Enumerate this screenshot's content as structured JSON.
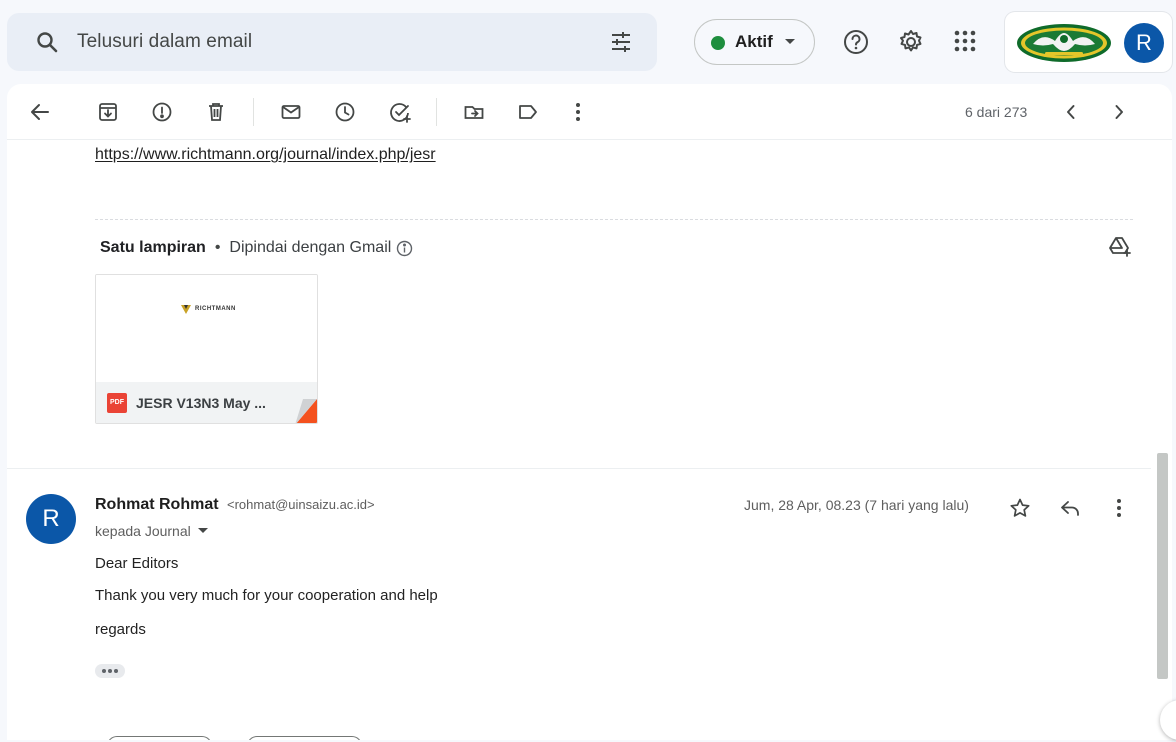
{
  "search": {
    "placeholder": "Telusuri dalam email"
  },
  "status": {
    "label": "Aktif",
    "color": "#1e8e3e"
  },
  "header_icons": [
    "help-icon",
    "settings-icon",
    "apps-grid-icon"
  ],
  "account": {
    "avatar_letter": "R",
    "avatar_color": "#0b57a8"
  },
  "toolbar": {
    "actions": [
      "back",
      "archive",
      "report-spam",
      "delete",
      "mark-unread",
      "snooze",
      "add-to-tasks",
      "move-to",
      "labels",
      "more"
    ],
    "pager": "6 dari 273"
  },
  "message_prev": {
    "link": "https://www.richtmann.org/journal/index.php/jesr",
    "attachments": {
      "title": "Satu lampiran",
      "separator": "•",
      "scan_note": "Dipindai dengan Gmail",
      "file_type": "PDF",
      "file_name": "JESR V13N3 May ...",
      "preview_brand": "RICHTMANN"
    }
  },
  "message": {
    "avatar_letter": "R",
    "sender_name": "Rohmat Rohmat",
    "sender_email": "<rohmat@uinsaizu.ac.id>",
    "to": "kepada Journal",
    "date": "Jum, 28 Apr, 08.23 (7 hari yang lalu)",
    "body": [
      "Dear Editors",
      "Thank you very much for your cooperation and help",
      "regards"
    ]
  }
}
